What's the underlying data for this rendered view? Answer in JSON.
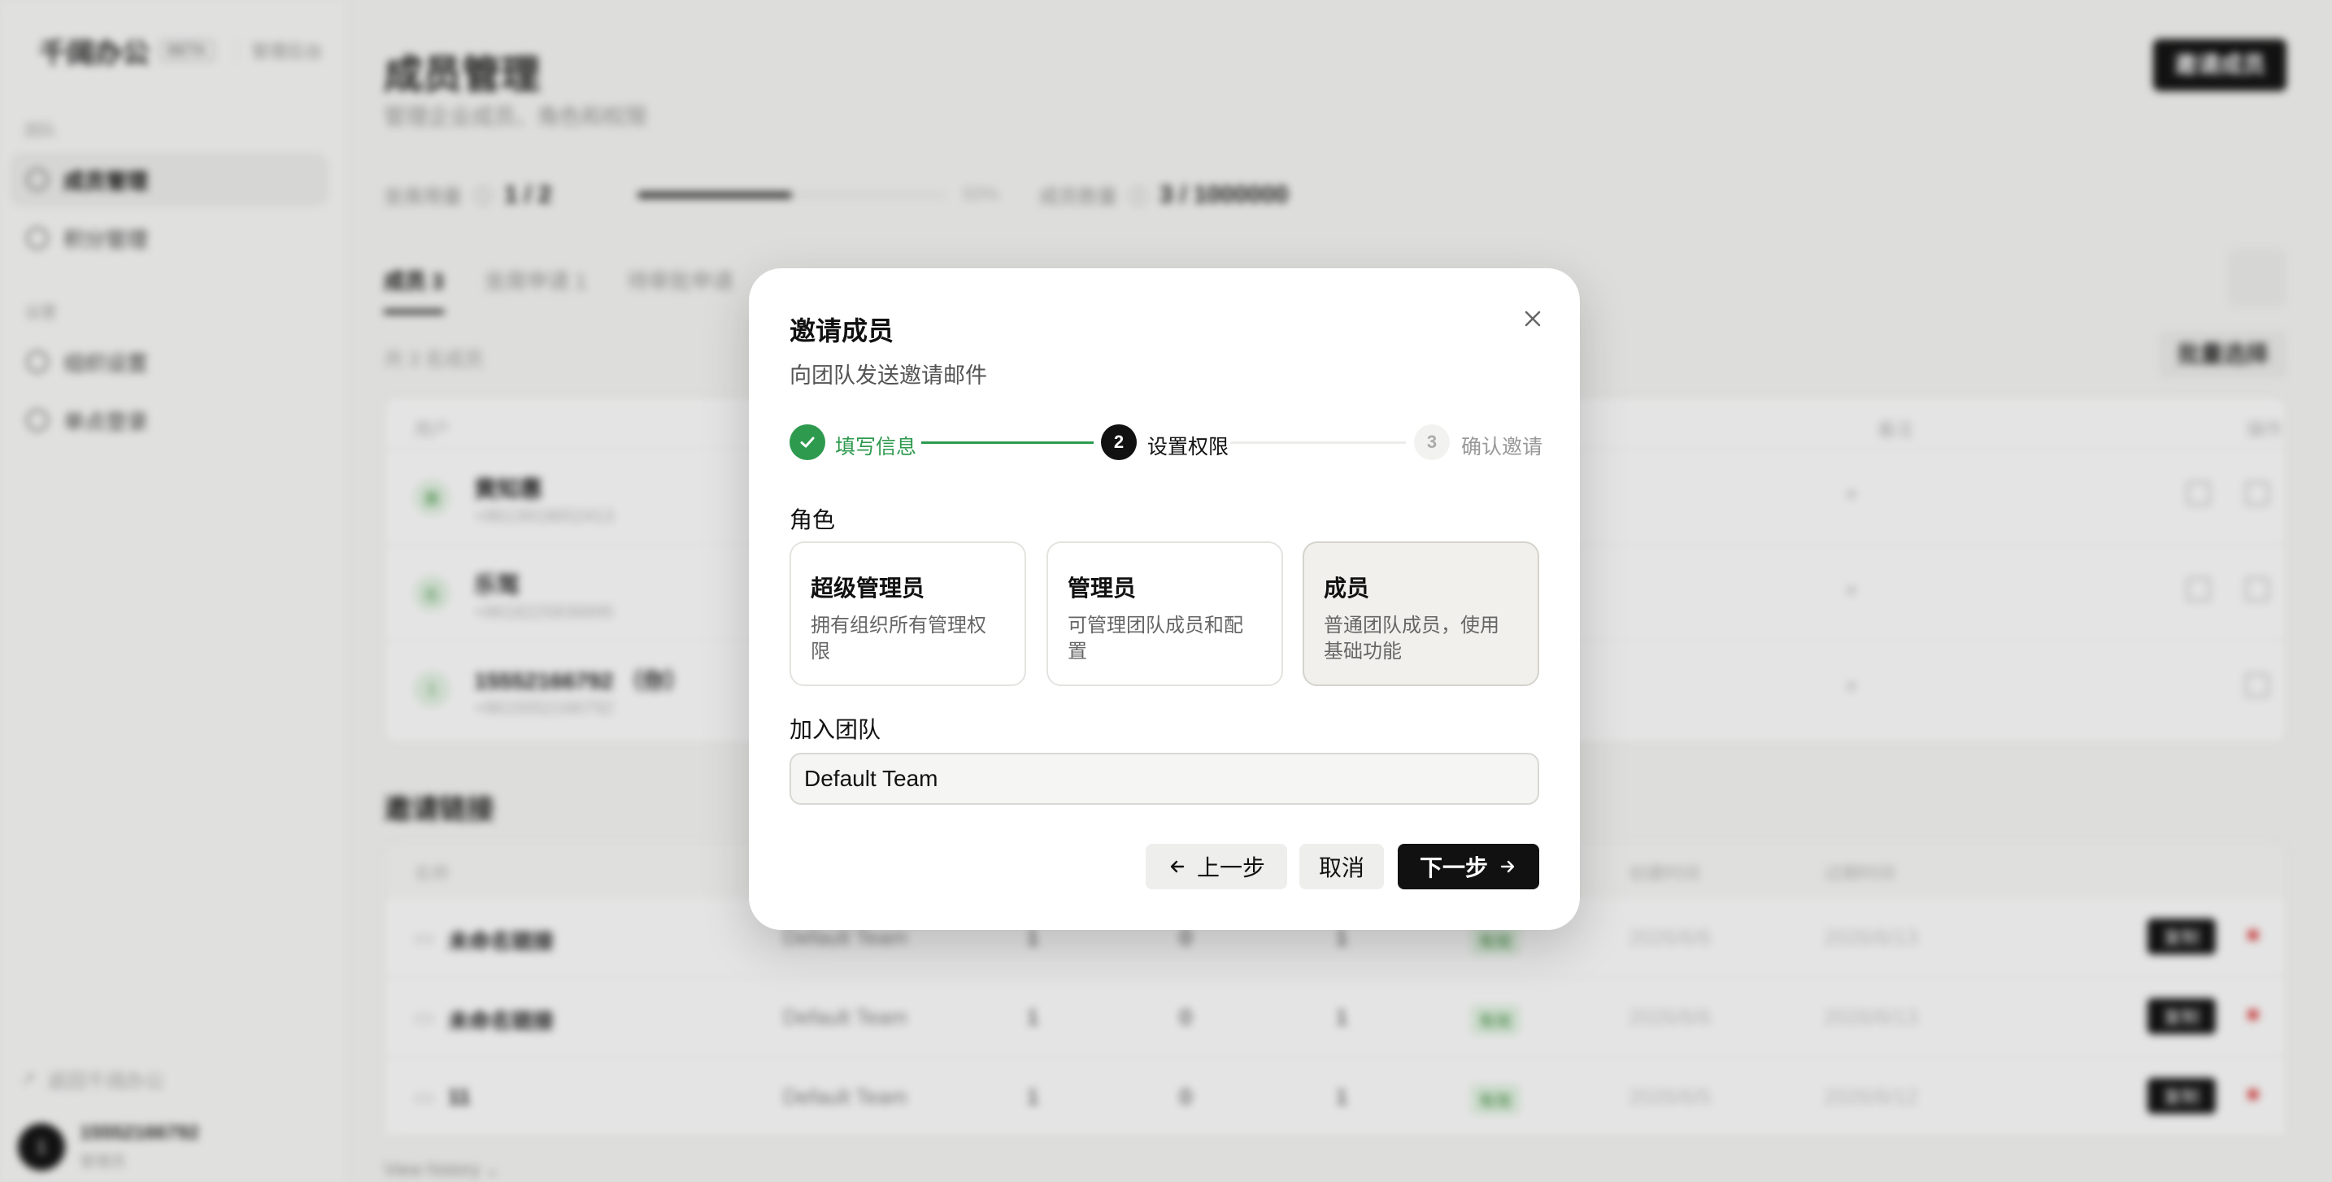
{
  "app": {
    "brand": "千阔办公",
    "brand_badge": "BETA",
    "brand_sub": "管理后台"
  },
  "sidebar": {
    "group_team": "团队",
    "group_settings": "设置",
    "items": [
      {
        "label": "成员管理",
        "active": true
      },
      {
        "label": "积分管理"
      },
      {
        "label": "组织设置"
      },
      {
        "label": "单点登录"
      }
    ],
    "footer_link": "返回千阔办公",
    "user": {
      "initial": "1",
      "name": "15552166792",
      "role": "管理员"
    }
  },
  "page": {
    "title": "成员管理",
    "subtitle": "管理企业成员、角色和权限",
    "invite_button": "邀请成员",
    "seat_label": "坐席用量",
    "seat_value": "1 / 2",
    "seat_progress": 0.5,
    "seat_pct": "50%",
    "member_count_label": "成员数量",
    "member_count_value": "3 / 1000000",
    "tabs": [
      {
        "label": "成员",
        "count": "3"
      },
      {
        "label": "坐席申请",
        "count": "1"
      },
      {
        "label": "待审批申请"
      }
    ],
    "count_line": "共 3 名成员",
    "bulk_button": "批量选择",
    "member_table": {
      "headers": [
        "用户",
        "备注",
        "操作"
      ],
      "rows": [
        {
          "initial": "黄",
          "name": "黄知惠",
          "phone": "+8613918652413",
          "note": "+"
        },
        {
          "initial": "乐",
          "name": "乐驾",
          "phone": "+8618225836895",
          "note": "+"
        },
        {
          "initial": "1",
          "name": "15552166792 （你）",
          "phone": "+8615552166792",
          "note": "+"
        }
      ]
    },
    "links_title": "邀请链接",
    "link_table": {
      "headers": [
        "名称",
        "创建时间",
        "过期时间"
      ],
      "rows": [
        {
          "name": "未命名链接",
          "team": "Default Team",
          "a": "1",
          "b": "0",
          "c": "1",
          "status": "有效",
          "created": "2026/6/6",
          "expires": "2026/6/13",
          "copy": "复制"
        },
        {
          "name": "未命名链接",
          "team": "Default Team",
          "a": "1",
          "b": "0",
          "c": "1",
          "status": "有效",
          "created": "2026/6/6",
          "expires": "2026/6/13",
          "copy": "复制"
        },
        {
          "name": "11",
          "team": "Default Team",
          "a": "1",
          "b": "0",
          "c": "1",
          "status": "有效",
          "created": "2026/6/5",
          "expires": "2026/6/12",
          "copy": "复制"
        }
      ]
    },
    "history_link": "View history"
  },
  "modal": {
    "title": "邀请成员",
    "subtitle": "向团队发送邀请邮件",
    "steps": [
      {
        "label": "填写信息",
        "state": "done"
      },
      {
        "number": "2",
        "label": "设置权限",
        "state": "current"
      },
      {
        "number": "3",
        "label": "确认邀请",
        "state": "pending"
      }
    ],
    "role_label": "角色",
    "roles": [
      {
        "name": "超级管理员",
        "desc": "拥有组织所有管理权限"
      },
      {
        "name": "管理员",
        "desc": "可管理团队成员和配置"
      },
      {
        "name": "成员",
        "desc": "普通团队成员，使用基础功能",
        "selected": true
      }
    ],
    "team_label": "加入团队",
    "team_value": "Default Team",
    "buttons": {
      "prev": "上一步",
      "cancel": "取消",
      "next": "下一步"
    },
    "colors": {
      "success": "#2e9a4e",
      "primary": "#111111"
    }
  }
}
